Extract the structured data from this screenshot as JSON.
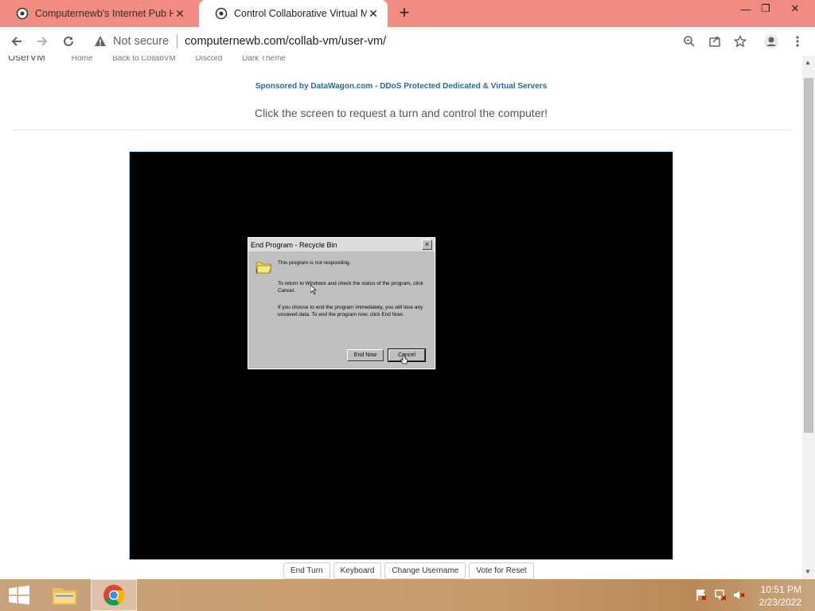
{
  "browser": {
    "tabs": [
      {
        "title": "Computernewb's Internet Pub H",
        "active": false
      },
      {
        "title": "Control Collaborative Virtual Ma",
        "active": true
      }
    ],
    "new_tab_symbol": "+",
    "address": {
      "security_label": "Not secure",
      "url": "computernewb.com/collab-vm/user-vm/"
    }
  },
  "page": {
    "nav": {
      "brand": "UserVM",
      "links": [
        "Home",
        "Back to CollabVM",
        "Discord",
        "Dark Theme"
      ]
    },
    "sponsor_text": "Sponsored by DataWagon.com - DDoS Protected Dedicated & Virtual Servers",
    "tagline": "Click the screen to request a turn and control the computer!",
    "vm_buttons": [
      "End Turn",
      "Keyboard",
      "Change Username",
      "Vote for Reset"
    ]
  },
  "vm_dialog": {
    "title": "End Program - Recycle Bin",
    "close_symbol": "×",
    "line1": "This program is not responding.",
    "line2": "To return to Windows and check the status of the program, click Cancel.",
    "line3": "If you choose to end the program immediately, you will lose any unsaved data. To end the program now, click End Now.",
    "end_now_label": "End Now",
    "cancel_label": "Cancel"
  },
  "taskbar": {
    "time": "10:51 PM",
    "date": "2/23/2022"
  },
  "colors": {
    "tab_strip": "#f28b82",
    "vm_border": "#9fd3f0",
    "sponsor_link": "#2a6a96"
  }
}
